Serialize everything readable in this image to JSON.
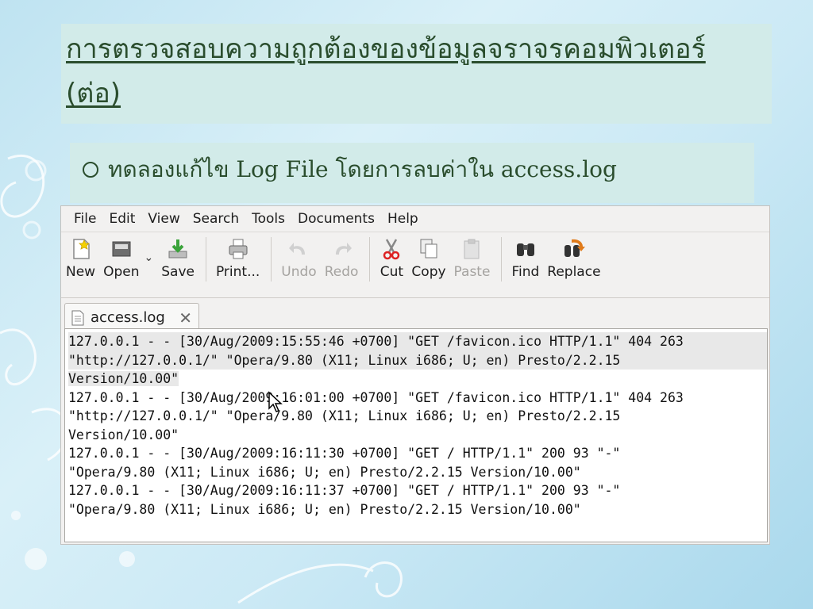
{
  "slide": {
    "title_line1": "การตรวจสอบความถูกต้องของข้อมูลจราจรคอมพิวเตอร์",
    "title_line2": "(ต่อ)",
    "bullet_text": "ทดลองแก้ไข Log File โดยการลบค่าใน access.log"
  },
  "menu": [
    "File",
    "Edit",
    "View",
    "Search",
    "Tools",
    "Documents",
    "Help"
  ],
  "toolbar": {
    "new": "New",
    "open": "Open",
    "save": "Save",
    "print": "Print...",
    "undo": "Undo",
    "redo": "Redo",
    "cut": "Cut",
    "copy": "Copy",
    "paste": "Paste",
    "find": "Find",
    "replace": "Replace"
  },
  "tab": {
    "label": "access.log",
    "close": "✕"
  },
  "editor": {
    "lines": [
      "127.0.0.1 - - [30/Aug/2009:15:55:46 +0700] \"GET /favicon.ico HTTP/1.1\" 404 263",
      "\"http://127.0.0.1/\" \"Opera/9.80 (X11; Linux i686; U; en) Presto/2.2.15",
      "Version/10.00\"",
      "127.0.0.1 - - [30/Aug/2009:16:01:00 +0700] \"GET /favicon.ico HTTP/1.1\" 404 263",
      "\"http://127.0.0.1/\" \"Opera/9.80 (X11; Linux i686; U; en) Presto/2.2.15",
      "Version/10.00\"",
      "127.0.0.1 - - [30/Aug/2009:16:11:30 +0700] \"GET / HTTP/1.1\" 200 93 \"-\"",
      "\"Opera/9.80 (X11; Linux i686; U; en) Presto/2.2.15 Version/10.00\"",
      "127.0.0.1 - - [30/Aug/2009:16:11:37 +0700] \"GET / HTTP/1.1\" 200 93 \"-\"",
      "\"Opera/9.80 (X11; Linux i686; U; en) Presto/2.2.15 Version/10.00\""
    ]
  },
  "colors": {
    "slide_text": "#2a4d2d",
    "box_bg": "#d2ebe9",
    "highlight_line": "#e8e8e8"
  }
}
